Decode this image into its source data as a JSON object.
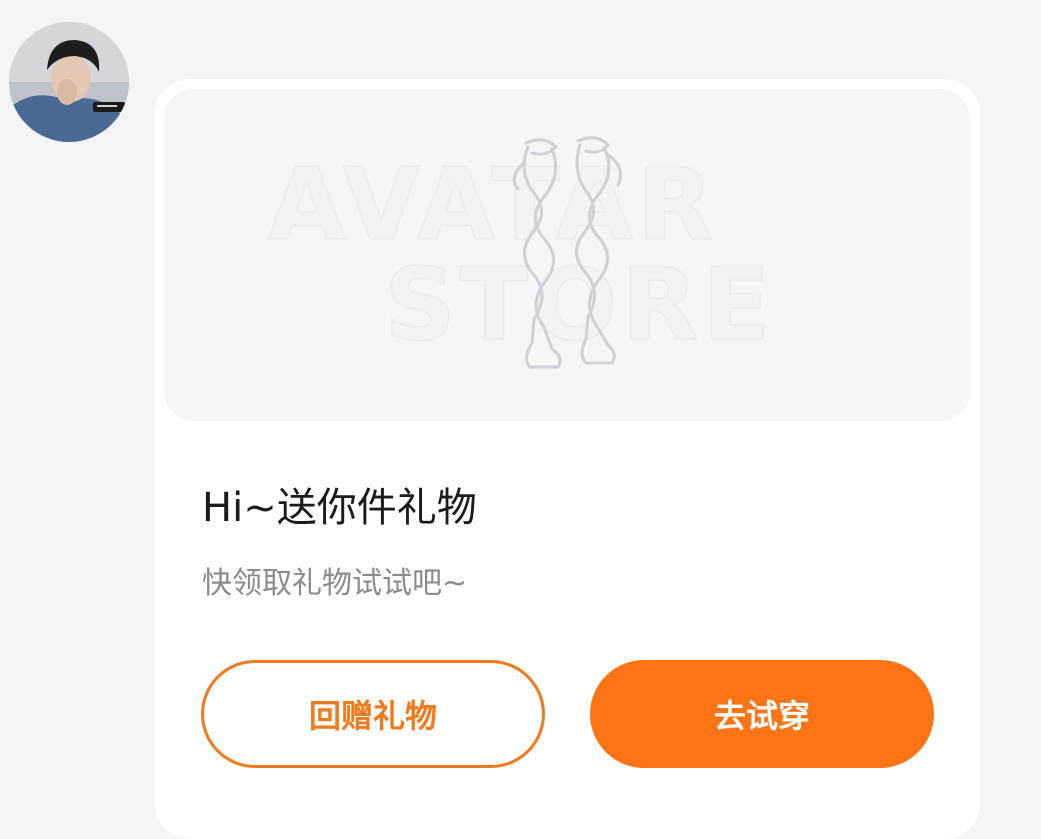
{
  "avatar": {
    "icon": "user-avatar-photo"
  },
  "gift_card": {
    "watermark": {
      "line1": "AVATAR",
      "line2": "STORE"
    },
    "item_image": "lace-up-boots-icon",
    "title": "Hi~送你件礼物",
    "subtitle": "快领取礼物试试吧~",
    "buttons": {
      "gift_back_label": "回赠礼物",
      "try_on_label": "去试穿"
    }
  },
  "colors": {
    "accent": "#ff7415",
    "outline_accent": "#f07a1c",
    "background": "#f5f5f7",
    "card": "#ffffff",
    "title_text": "#1b1b1d",
    "subtitle_text": "#8a8a8f"
  }
}
